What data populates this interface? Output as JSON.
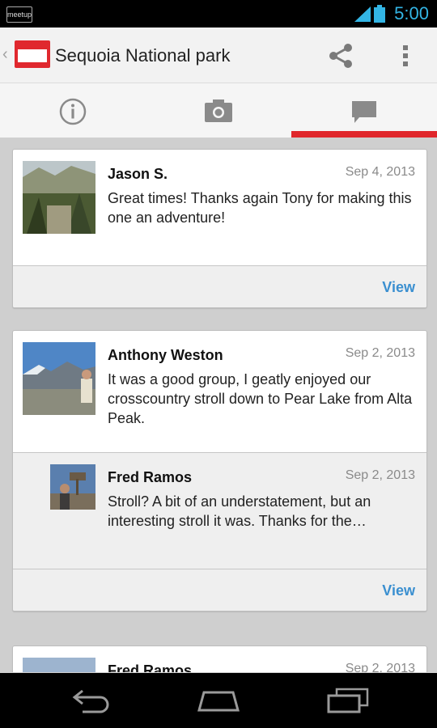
{
  "status_bar": {
    "app_badge": "meetup",
    "time": "5:00"
  },
  "action_bar": {
    "title": "Sequoia National park"
  },
  "tabs": [
    {
      "id": "info",
      "icon": "info-icon",
      "selected": false
    },
    {
      "id": "photos",
      "icon": "camera-icon",
      "selected": false
    },
    {
      "id": "comments",
      "icon": "comment-icon",
      "selected": true
    }
  ],
  "comments": [
    {
      "author": "Jason S.",
      "date": "Sep 4, 2013",
      "text": "Great times!  Thanks again Tony for making this one an adventure!",
      "view_label": "View",
      "replies": []
    },
    {
      "author": "Anthony Weston",
      "date": "Sep 2, 2013",
      "text": "It was a good group, I geatly enjoyed our crosscountry stroll down to Pear Lake from Alta Peak.",
      "view_label": "View",
      "replies": [
        {
          "author": "Fred Ramos",
          "date": "Sep 2, 2013",
          "text": "Stroll? A bit of an understatement, but an interesting stroll it was.  Thanks for the…"
        }
      ]
    },
    {
      "author": "Fred Ramos",
      "date": "Sep 2, 2013",
      "text": "",
      "replies": []
    }
  ],
  "colors": {
    "accent_red": "#e0262b",
    "link_blue": "#3a8fd0",
    "status_blue": "#33b5e5"
  }
}
